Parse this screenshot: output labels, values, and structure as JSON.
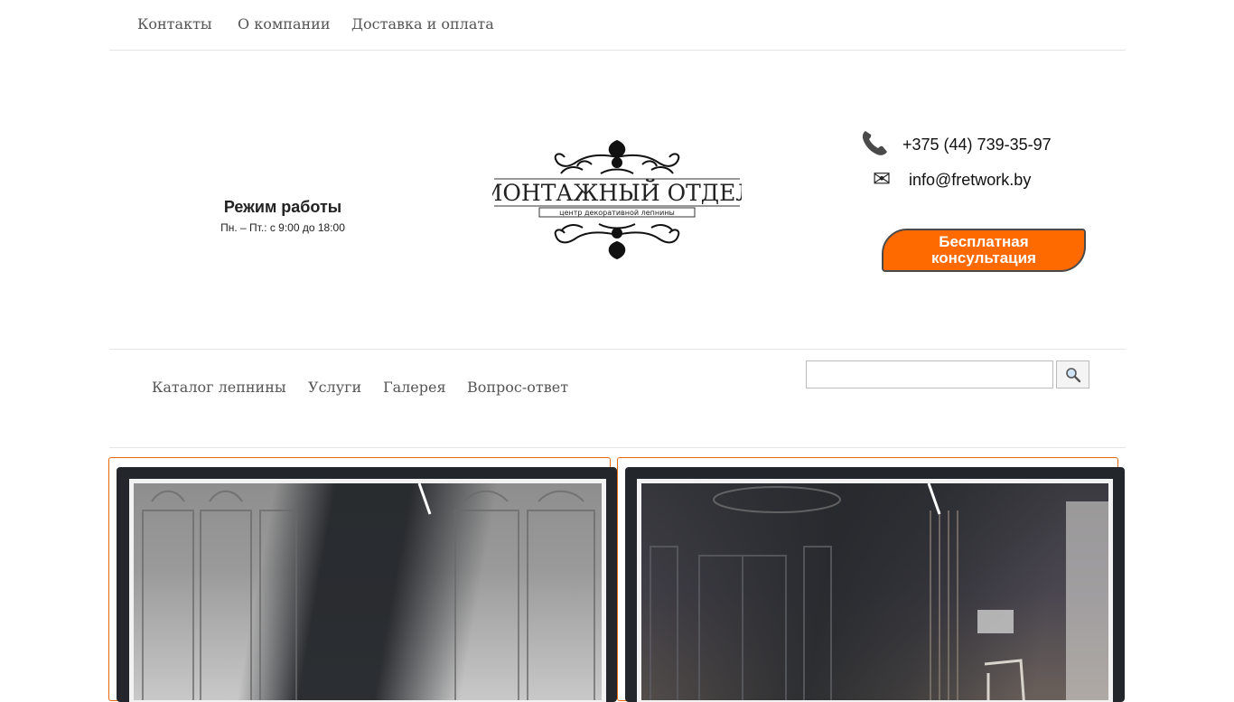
{
  "top_nav": {
    "items": [
      "Контакты",
      "О компании",
      "Доставка и оплата"
    ]
  },
  "hours": {
    "title": "Режим работы",
    "text": "Пн. – Пт.: с 9:00 до 18:00"
  },
  "logo": {
    "title": "МОНТАЖНЫЙ ОТДЕЛ",
    "subtitle": "центр декоративной лепнины"
  },
  "contacts": {
    "phone": "+375 (44) 739-35-97",
    "email": "info@fretwork.by",
    "phone_icon": "phone-icon",
    "email_icon": "envelope-icon"
  },
  "consult_button": {
    "label_line1": "Бесплатная",
    "label_line2": "консультация",
    "color": "#ff6a00"
  },
  "main_nav": {
    "items": [
      "Каталог лепнины",
      "Услуги",
      "Галерея",
      "Вопрос-ответ"
    ]
  },
  "search": {
    "value": "",
    "placeholder": "",
    "button_icon": "search-icon"
  },
  "colors": {
    "accent": "#ff6a00",
    "card_frame": "#23262a",
    "card_border": "#e5680e"
  }
}
